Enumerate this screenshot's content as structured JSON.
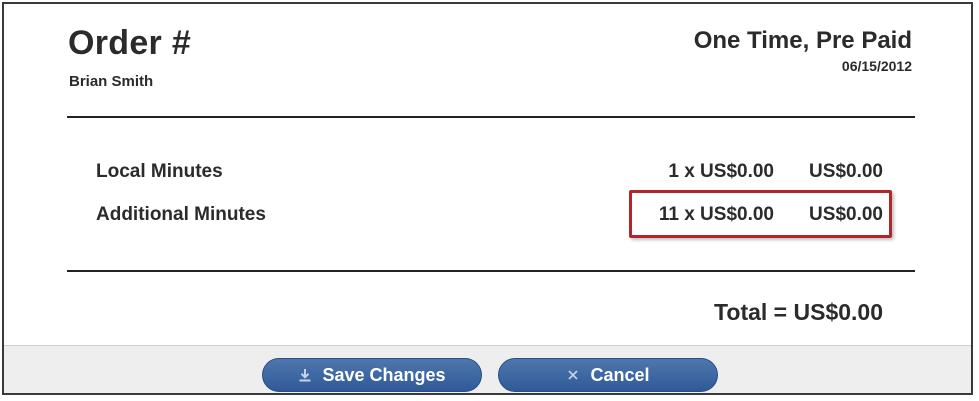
{
  "order": {
    "title": "Order #",
    "customer_name": "Brian Smith",
    "type": "One Time, Pre Paid",
    "date": "06/15/2012"
  },
  "line_items": [
    {
      "name": "Local Minutes",
      "quantity_price": "1 x US$0.00",
      "amount": "US$0.00"
    },
    {
      "name": "Additional Minutes",
      "quantity_price": "11 x US$0.00",
      "amount": "US$0.00"
    }
  ],
  "total": {
    "label": "Total = US$0.00"
  },
  "footer": {
    "save_label": "Save Changes",
    "save_icon": "download-icon",
    "cancel_label": "Cancel",
    "cancel_icon": "close-icon"
  },
  "colors": {
    "highlight": "#b0262b",
    "button": "#3a64a0"
  }
}
